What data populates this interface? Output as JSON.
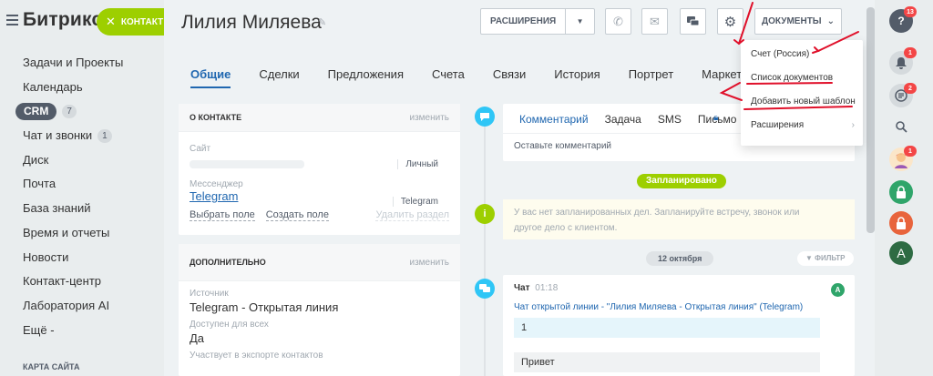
{
  "sidebar": {
    "logo": "Битрикс",
    "contact_button": "КОНТАКТ",
    "items": [
      {
        "label": "Задачи и Проекты"
      },
      {
        "label": "Календарь"
      },
      {
        "label": "CRM",
        "count": "7"
      },
      {
        "label": "Чат и звонки",
        "count": "1"
      },
      {
        "label": "Диск"
      },
      {
        "label": "Почта"
      },
      {
        "label": "База знаний"
      },
      {
        "label": "Время и отчеты"
      },
      {
        "label": "Новости"
      },
      {
        "label": "Контакт-центр"
      },
      {
        "label": "Лаборатория AI"
      },
      {
        "label": "Ещё -"
      }
    ],
    "sitemap": "КАРТА САЙТА"
  },
  "header": {
    "title": "Лилия  Миляева",
    "extensions_button": "РАСШИРЕНИЯ",
    "documents_button": "ДОКУМЕНТЫ"
  },
  "tabs": [
    "Общие",
    "Сделки",
    "Предложения",
    "Счета",
    "Связи",
    "История",
    "Портрет",
    "Маркет"
  ],
  "about": {
    "title": "О КОНТАКТЕ",
    "edit": "изменить",
    "site_label": "Сайт",
    "site_type": "Личный",
    "messenger_label": "Мессенджер",
    "messenger_value": "Telegram",
    "messenger_type": "Telegram",
    "choose_field": "Выбрать поле",
    "create_field": "Создать поле",
    "delete_section": "Удалить раздел"
  },
  "more": {
    "title": "ДОПОЛНИТЕЛЬНО",
    "edit": "изменить",
    "source_label": "Источник",
    "source_value": "Telegram - Открытая линия",
    "available_label": "Доступен для всех",
    "available_value": "Да",
    "export_label": "Участвует в экспорте контактов"
  },
  "editor": {
    "tabs": [
      "Комментарий",
      "Задача",
      "SMS",
      "Письмо"
    ],
    "placeholder": "Оставьте комментарий"
  },
  "timeline": {
    "planned_badge": "Запланировано",
    "notice_line1": "У вас нет запланированных дел. Запланируйте встречу, звонок или",
    "notice_line2": "другое дело с клиентом.",
    "date": "12 октября",
    "filter": "ФИЛЬТР",
    "chat_title": "Чат",
    "chat_time": "01:18",
    "chat_subtitle": "Чат открытой линии - \"Лилия Миляева - Открытая линия\" (Telegram)",
    "message1": "1",
    "message2": "Привет",
    "avatar_letter": "A"
  },
  "dropdown": {
    "items": [
      "Счет (Россия)",
      "Список документов",
      "Добавить новый шаблон",
      "Расширения"
    ]
  },
  "rightbar": {
    "help_badge": "13",
    "notif_badge": "1",
    "tasks_badge": "2",
    "user_badge": "1",
    "avatar_letter": "A"
  },
  "colors": {
    "accent_green": "#9dcf00",
    "link_blue": "#2067b0",
    "annotation_red": "#e0102a"
  }
}
